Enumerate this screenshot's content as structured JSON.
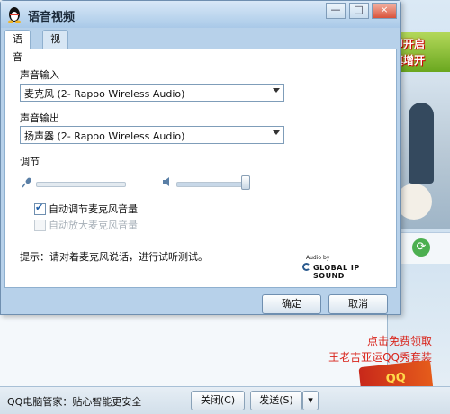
{
  "dialog": {
    "title": "语音视频",
    "window_buttons": {
      "minimize": "—",
      "maximize": "□",
      "close": "×"
    },
    "tabs": [
      {
        "label": "语音",
        "active": true
      },
      {
        "label": "视频",
        "active": false
      }
    ],
    "voice": {
      "input_label": "声音输入",
      "input_value": "麦克风 (2- Rapoo Wireless Audio)",
      "output_label": "声音输出",
      "output_value": "扬声器 (2- Rapoo Wireless Audio)",
      "adjust_label": "调节",
      "mic_level": 0.0,
      "speaker_level": 0.9,
      "auto_adjust_label": "自动调节麦克风音量",
      "auto_adjust_checked": true,
      "auto_amplify_label": "自动放大麦克风音量",
      "auto_amplify_checked": false,
      "hint": "提示：请对着麦克风说话，进行试听测试。",
      "audio_by": "Audio by",
      "brand": "GLOBAL IP SOUND"
    },
    "ok_label": "确定",
    "cancel_label": "取消"
  },
  "background": {
    "ad_line1": "即开启",
    "ad_line2": "填增开",
    "promo_line1": "点击免费领取",
    "promo_line2": "王老吉亚运QQ秀套装",
    "status_text": "QQ电脑管家：贴心智能更安全",
    "close_label": "关闭(C)",
    "send_label": "发送(S)",
    "send_dropdown": "▾"
  },
  "colors": {
    "dialog_bg": "#b7d1ea",
    "promo_red": "#d9241b",
    "check_blue": "#1e5ea8"
  }
}
